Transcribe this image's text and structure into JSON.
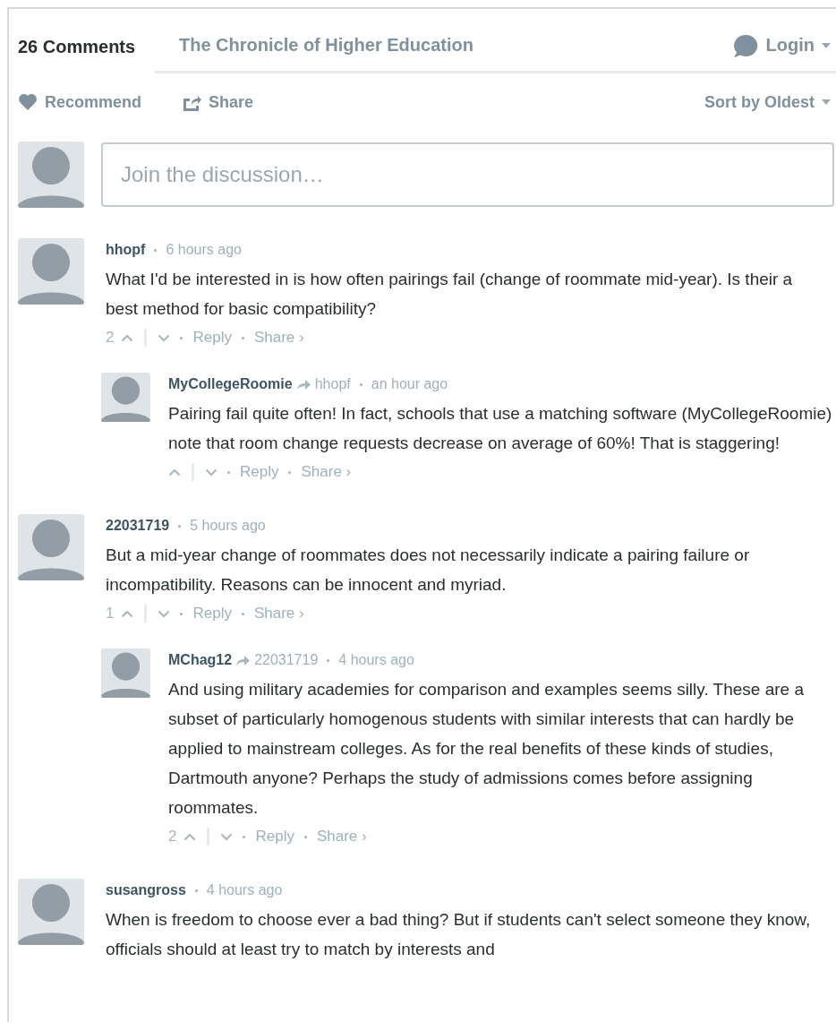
{
  "header": {
    "comment_count": "26 Comments",
    "site_tab": "The Chronicle of Higher Education",
    "login": "Login"
  },
  "toolbar": {
    "recommend": "Recommend",
    "share": "Share",
    "sort": "Sort by Oldest"
  },
  "composer": {
    "placeholder": "Join the discussion…"
  },
  "comments": [
    {
      "author": "hhopf",
      "time": "6 hours ago",
      "text": "What I'd be interested in is how often pairings fail (change of roommate mid-year). Is their a best method for basic compatibility?",
      "upvotes": "2",
      "reply": "Reply",
      "share": "Share ›",
      "children": [
        {
          "author": "MyCollegeRoomie",
          "reply_to": "hhopf",
          "time": "an hour ago",
          "text": "Pairing fail quite often! In fact, schools that use a matching software (MyCollegeRoomie) note that room change requests decrease on average of 60%! That is staggering!",
          "reply": "Reply",
          "share": "Share ›"
        }
      ]
    },
    {
      "author": "22031719",
      "time": "5 hours ago",
      "text": "But a mid-year change of roommates does not necessarily indicate a pairing failure or incompatibility. Reasons can be innocent and myriad.",
      "upvotes": "1",
      "reply": "Reply",
      "share": "Share ›",
      "children": [
        {
          "author": "MChag12",
          "reply_to": "22031719",
          "time": "4 hours ago",
          "text": "And using military academies for comparison and examples seems silly. These are a subset of particularly homogenous students with similar interests that can hardly be applied to mainstream colleges. As for the real benefits of these kinds of studies, Dartmouth anyone? Perhaps the study of admissions comes before assigning roommates.",
          "upvotes": "2",
          "reply": "Reply",
          "share": "Share ›"
        }
      ]
    },
    {
      "author": "susangross",
      "time": "4 hours ago",
      "text": "When is freedom to choose ever a bad thing? But if students can't select someone they know, officials should at least try to match by interests and"
    }
  ]
}
